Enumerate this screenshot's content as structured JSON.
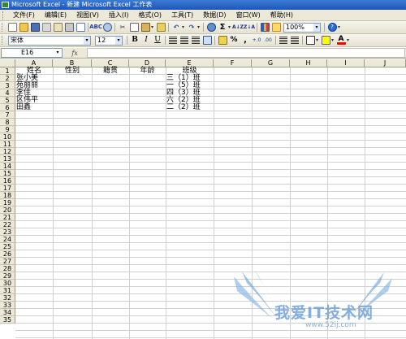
{
  "window": {
    "title": "Microsoft Excel - 新建 Microsoft Excel 工作表"
  },
  "menu": [
    "文件(F)",
    "编辑(E)",
    "视图(V)",
    "插入(I)",
    "格式(O)",
    "工具(T)",
    "数据(D)",
    "窗口(W)",
    "帮助(H)"
  ],
  "toolbar": {
    "zoom": "100%",
    "font": "宋体",
    "font_size": "12",
    "bold": "B",
    "italic": "I",
    "underline": "U",
    "sum": "Σ",
    "percent": "%",
    "comma": ",",
    "help": "?",
    "font_color_letter": "A",
    "spell": "ABC",
    "sort_az": "A↓Z",
    "sort_za": "Z↓A",
    "undo": "↶",
    "redo": "↷",
    "cut": "✂",
    "dec_inc": "+.0",
    "dec_dec": ".00",
    "dropdown": "▾"
  },
  "formula_bar": {
    "name_box": "E16",
    "fx": "fx",
    "content": ""
  },
  "grid": {
    "columns": [
      "A",
      "B",
      "C",
      "D",
      "E",
      "F",
      "G",
      "H",
      "I",
      "J"
    ],
    "rows": [
      "1",
      "2",
      "3",
      "4",
      "5",
      "6",
      "7",
      "8",
      "9",
      "10",
      "11",
      "12",
      "13",
      "14",
      "15",
      "16",
      "17",
      "18",
      "19",
      "20",
      "21",
      "22",
      "23",
      "24",
      "25",
      "26",
      "27",
      "28",
      "29",
      "30",
      "31",
      "32",
      "33",
      "34",
      "35"
    ],
    "headers": {
      "A": "姓名",
      "B": "性别",
      "C": "籍贯",
      "D": "年龄",
      "E": "班级"
    },
    "names": [
      "张小美",
      "苑丽丽",
      "李佳",
      "区伟平",
      "田鑫"
    ],
    "classes": [
      "三（1）班",
      "一（5）班",
      "四（3）班",
      "六（2）班",
      "二（2）班"
    ]
  },
  "watermark": {
    "text": "我爱IT技术网",
    "url": "www.52ij.com"
  }
}
